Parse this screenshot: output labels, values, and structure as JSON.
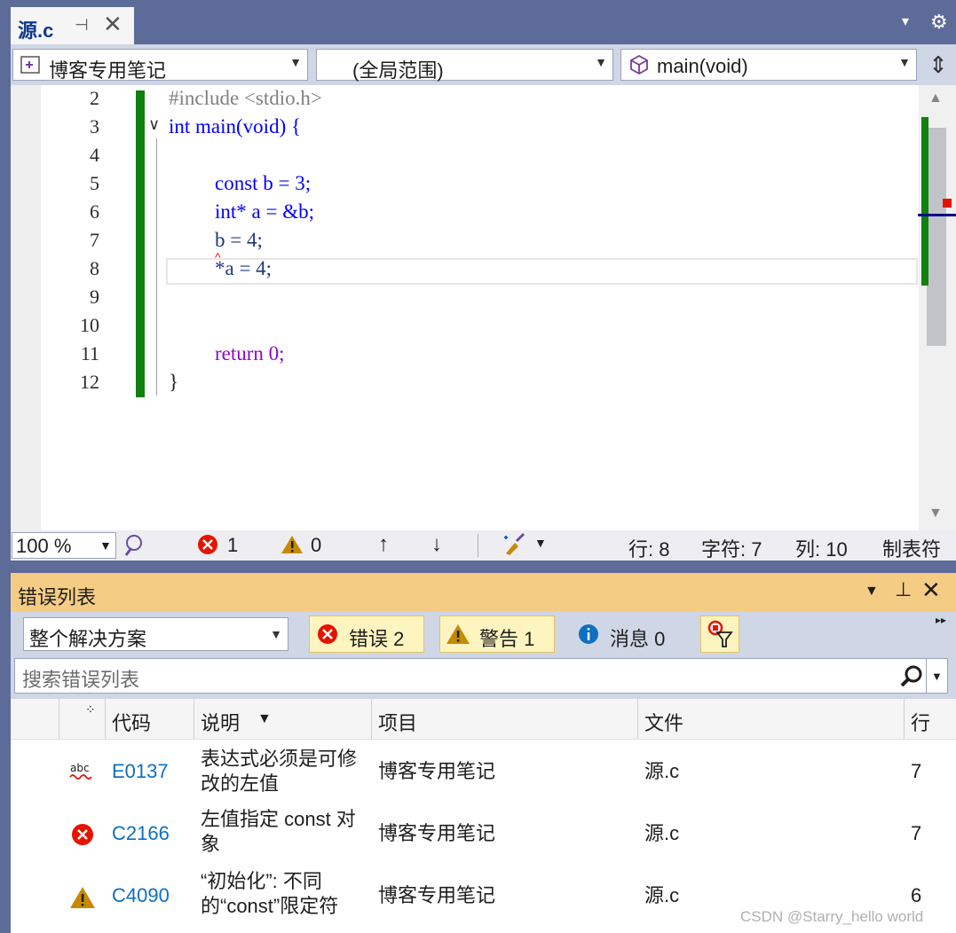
{
  "tab": {
    "title": "源.c",
    "pin": "⊣",
    "close": "✕"
  },
  "window": {
    "dropdown": "▾",
    "settings": "⚙"
  },
  "nav": {
    "project": "博客专用笔记",
    "scope": "(全局范围)",
    "member": "main(void)"
  },
  "editor": {
    "lines": [
      {
        "num": "2",
        "code": "#include <stdio.h>"
      },
      {
        "num": "3",
        "code": "int main(void) {"
      },
      {
        "num": "4",
        "code": ""
      },
      {
        "num": "5",
        "code": "const b = 3;"
      },
      {
        "num": "6",
        "code": "int* a = &b;"
      },
      {
        "num": "7",
        "code": "b = 4;"
      },
      {
        "num": "8",
        "code": "*a = 4;"
      },
      {
        "num": "9",
        "code": ""
      },
      {
        "num": "10",
        "code": ""
      },
      {
        "num": "11",
        "code": "return 0;"
      },
      {
        "num": "12",
        "code": "}"
      }
    ]
  },
  "status": {
    "zoom": "100 %",
    "errors": "1",
    "warnings": "0",
    "up": "↑",
    "down": "↓",
    "line": "行: 8",
    "char": "字符: 7",
    "col": "列: 10",
    "tab_mode": "制表符"
  },
  "error_list": {
    "title": "错误列表",
    "scope_filter": "整个解决方案",
    "errors_btn": "错误 2",
    "warnings_btn": "警告 1",
    "messages_btn": "消息 0",
    "search_placeholder": "搜索错误列表",
    "columns": {
      "code": "代码",
      "desc": "说明",
      "project": "项目",
      "file": "文件",
      "line": "行"
    },
    "rows": [
      {
        "icon": "abc",
        "code": "E0137",
        "desc": [
          "表达式必须是可修",
          "改的左值"
        ],
        "project": "博客专用笔记",
        "file": "源.c",
        "line": "7"
      },
      {
        "icon": "error",
        "code": "C2166",
        "desc": [
          "左值指定 const 对",
          "象"
        ],
        "project": "博客专用笔记",
        "file": "源.c",
        "line": "7"
      },
      {
        "icon": "warning",
        "code": "C4090",
        "desc": [
          "“初始化”: 不同",
          "的“const”限定符"
        ],
        "project": "博客专用笔记",
        "file": "源.c",
        "line": "6"
      }
    ]
  },
  "watermark": "CSDN @Starry_hello world",
  "colors": {
    "accent": "#5d6b99",
    "error": "#e51400",
    "warning": "#c68a00",
    "info": "#0e70c0",
    "change": "#108010"
  }
}
